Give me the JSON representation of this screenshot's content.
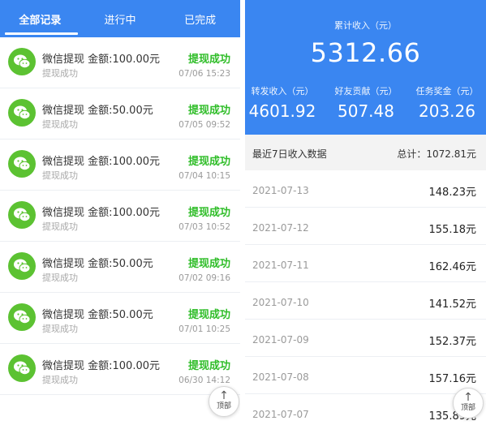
{
  "left": {
    "tabs": [
      {
        "label": "全部记录",
        "active": true
      },
      {
        "label": "进行中",
        "active": false
      },
      {
        "label": "已完成",
        "active": false
      }
    ],
    "records": [
      {
        "title": "微信提现 金额:100.00元",
        "sub": "提现成功",
        "status": "提现成功",
        "time": "07/06 15:23"
      },
      {
        "title": "微信提现 金额:50.00元",
        "sub": "提现成功",
        "status": "提现成功",
        "time": "07/05 09:52"
      },
      {
        "title": "微信提现 金额:100.00元",
        "sub": "提现成功",
        "status": "提现成功",
        "time": "07/04 10:15"
      },
      {
        "title": "微信提现 金额:100.00元",
        "sub": "提现成功",
        "status": "提现成功",
        "time": "07/03 10:52"
      },
      {
        "title": "微信提现 金额:50.00元",
        "sub": "提现成功",
        "status": "提现成功",
        "time": "07/02 09:16"
      },
      {
        "title": "微信提现 金额:50.00元",
        "sub": "提现成功",
        "status": "提现成功",
        "time": "07/01 10:25"
      },
      {
        "title": "微信提现 金额:100.00元",
        "sub": "提现成功",
        "status": "提现成功",
        "time": "06/30 14:12"
      }
    ],
    "record_icon": "wechat-icon",
    "status_color": "#2fbd28",
    "top_button": {
      "arrow": "↑",
      "label": "顶部"
    }
  },
  "right": {
    "total": {
      "label": "累计收入（元）",
      "value": "5312.66"
    },
    "stats": [
      {
        "label": "转发收入（元）",
        "value": "4601.92"
      },
      {
        "label": "好友贡献（元）",
        "value": "507.48"
      },
      {
        "label": "任务奖金（元）",
        "value": "203.26"
      }
    ],
    "summary": {
      "title": "最近7日收入数据",
      "total": "总计：1072.81元"
    },
    "days": [
      {
        "date": "2021-07-13",
        "amount": "148.23元"
      },
      {
        "date": "2021-07-12",
        "amount": "155.18元"
      },
      {
        "date": "2021-07-11",
        "amount": "162.46元"
      },
      {
        "date": "2021-07-10",
        "amount": "141.52元"
      },
      {
        "date": "2021-07-09",
        "amount": "152.37元"
      },
      {
        "date": "2021-07-08",
        "amount": "157.16元"
      },
      {
        "date": "2021-07-07",
        "amount": "135.89元"
      }
    ],
    "top_button": {
      "arrow": "↑",
      "label": "顶部"
    }
  },
  "colors": {
    "brand_blue": "#3a86f1",
    "wechat_green": "#5cc232"
  }
}
